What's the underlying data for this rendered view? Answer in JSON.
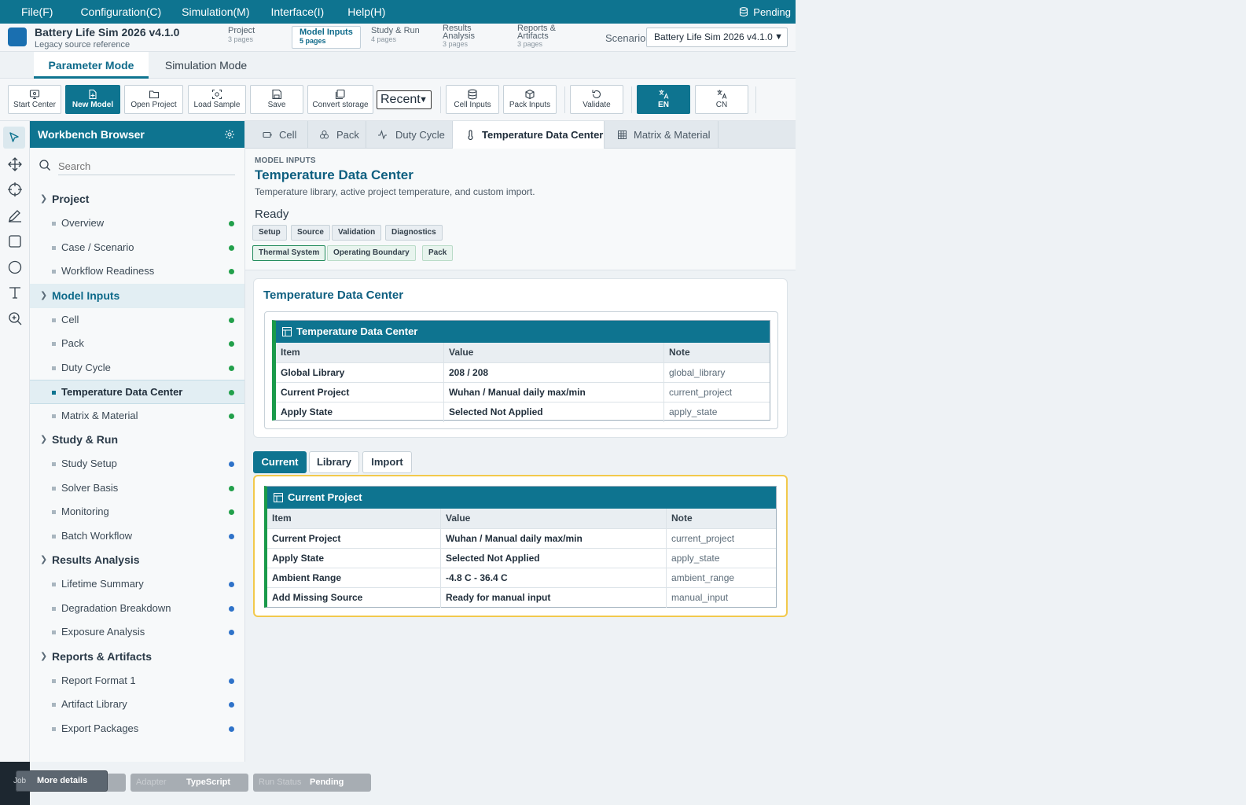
{
  "menu": [
    "File(F)",
    "Configuration(C)",
    "Simulation(M)",
    "Interface(I)",
    "Help(H)"
  ],
  "menu_status": "Pending",
  "app": {
    "title": "Battery Life Sim 2026 v4.1.0",
    "subtitle": "Legacy source reference"
  },
  "page_groups": [
    {
      "name": "Project",
      "count": "3 pages"
    },
    {
      "name": "Model Inputs",
      "count": "5 pages"
    },
    {
      "name": "Study & Run",
      "count": "4 pages"
    },
    {
      "name": "Results Analysis",
      "count": "3 pages"
    },
    {
      "name": "Reports & Artifacts",
      "count": "3 pages"
    }
  ],
  "scenario": {
    "label": "Scenario",
    "value": "Battery Life Sim 2026 v4.1.0"
  },
  "modes": [
    "Parameter Mode",
    "Simulation Mode"
  ],
  "toolbar": {
    "start_center": "Start Center",
    "new_model": "New Model",
    "open_project": "Open Project",
    "load_sample": "Load Sample",
    "save": "Save",
    "convert_storage": "Convert storage",
    "recent": "Recent",
    "cell_inputs": "Cell Inputs",
    "pack_inputs": "Pack Inputs",
    "validate": "Validate",
    "en": "EN",
    "cn": "CN"
  },
  "sidebar": {
    "title": "Workbench Browser",
    "search_placeholder": "Search",
    "groups": [
      {
        "label": "Project",
        "items": [
          {
            "label": "Overview",
            "status": "#22a04b"
          },
          {
            "label": "Case / Scenario",
            "status": "#22a04b"
          },
          {
            "label": "Workflow Readiness",
            "status": "#22a04b"
          }
        ]
      },
      {
        "label": "Model Inputs",
        "items": [
          {
            "label": "Cell",
            "status": "#22a04b"
          },
          {
            "label": "Pack",
            "status": "#22a04b"
          },
          {
            "label": "Duty Cycle",
            "status": "#22a04b"
          },
          {
            "label": "Temperature Data Center",
            "status": "#22a04b"
          },
          {
            "label": "Matrix & Material",
            "status": "#22a04b"
          }
        ]
      },
      {
        "label": "Study & Run",
        "items": [
          {
            "label": "Study Setup",
            "status": "#2f73c9"
          },
          {
            "label": "Solver Basis",
            "status": "#22a04b"
          },
          {
            "label": "Monitoring",
            "status": "#22a04b"
          },
          {
            "label": "Batch Workflow",
            "status": "#2f73c9"
          }
        ]
      },
      {
        "label": "Results Analysis",
        "items": [
          {
            "label": "Lifetime Summary",
            "status": "#2f73c9"
          },
          {
            "label": "Degradation Breakdown",
            "status": "#2f73c9"
          },
          {
            "label": "Exposure Analysis",
            "status": "#2f73c9"
          }
        ]
      },
      {
        "label": "Reports & Artifacts",
        "items": [
          {
            "label": "Report Format 1",
            "status": "#2f73c9"
          },
          {
            "label": "Artifact Library",
            "status": "#2f73c9"
          },
          {
            "label": "Export Packages",
            "status": "#2f73c9"
          }
        ]
      }
    ]
  },
  "content_tabs": [
    "Cell",
    "Pack",
    "Duty Cycle",
    "Temperature Data Center",
    "Matrix & Material"
  ],
  "page": {
    "breadcrumb": "MODEL INPUTS",
    "title": "Temperature Data Center",
    "description": "Temperature library, active project temperature, and custom import.",
    "state": "Ready",
    "chips_row1": [
      "Setup",
      "Source",
      "Validation",
      "Diagnostics"
    ],
    "chips_row2": [
      "Thermal System",
      "Operating Boundary",
      "Pack"
    ]
  },
  "summary_card": {
    "title": "Temperature Data Center",
    "table_title": "Temperature Data Center",
    "columns": [
      "Item",
      "Value",
      "Note"
    ],
    "rows": [
      [
        "Global Library",
        "208 / 208",
        "global_library"
      ],
      [
        "Current Project",
        "Wuhan / Manual daily max/min",
        "current_project"
      ],
      [
        "Apply State",
        "Selected Not Applied",
        "apply_state"
      ]
    ]
  },
  "segments": [
    "Current",
    "Library",
    "Import"
  ],
  "current_card": {
    "table_title": "Current Project",
    "columns": [
      "Item",
      "Value",
      "Note"
    ],
    "rows": [
      [
        "Current Project",
        "Wuhan / Manual daily max/min",
        "current_project"
      ],
      [
        "Apply State",
        "Selected Not Applied",
        "apply_state"
      ],
      [
        "Ambient Range",
        "-4.8 C - 36.4 C",
        "ambient_range"
      ],
      [
        "Add Missing Source",
        "Ready for manual input",
        "manual_input"
      ]
    ]
  },
  "statusbar": {
    "job_key": "Job",
    "more_details": "More details",
    "adapter_key": "Adapter",
    "adapter_value": "TypeScript",
    "run_status_key": "Run Status",
    "run_status_value": "Pending"
  },
  "colors": {
    "accent": "#0e7490",
    "ok": "#22a04b",
    "info": "#2f73c9",
    "highlight": "#f2c94c"
  }
}
